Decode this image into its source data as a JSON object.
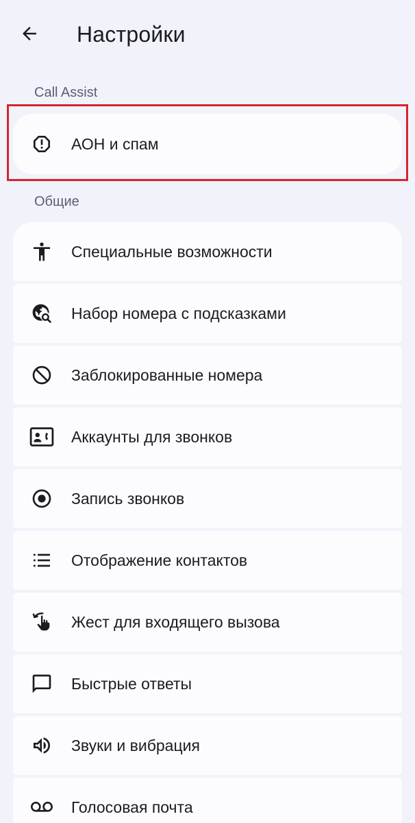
{
  "header": {
    "title": "Настройки",
    "back_icon": "arrow-back-icon"
  },
  "sections": {
    "call_assist": {
      "title": "Call Assist",
      "items": [
        {
          "label": "АОН и спам",
          "icon": "report-octagon-icon"
        }
      ]
    },
    "general": {
      "title": "Общие",
      "items": [
        {
          "label": "Специальные возможности",
          "icon": "accessibility-icon"
        },
        {
          "label": "Набор номера с подсказками",
          "icon": "travel-explore-icon"
        },
        {
          "label": "Заблокированные номера",
          "icon": "block-icon"
        },
        {
          "label": "Аккаунты для звонков",
          "icon": "contact-phone-icon"
        },
        {
          "label": "Запись звонков",
          "icon": "record-icon"
        },
        {
          "label": "Отображение контактов",
          "icon": "list-icon"
        },
        {
          "label": "Жест для входящего вызова",
          "icon": "swipe-gesture-icon"
        },
        {
          "label": "Быстрые ответы",
          "icon": "chat-bubble-icon"
        },
        {
          "label": "Звуки и вибрация",
          "icon": "volume-icon"
        },
        {
          "label": "Голосовая почта",
          "icon": "voicemail-icon"
        }
      ]
    }
  },
  "colors": {
    "background": "#f1f2fa",
    "card": "#fcfcff",
    "highlight": "#d32531",
    "section_header": "#5b5e71"
  }
}
